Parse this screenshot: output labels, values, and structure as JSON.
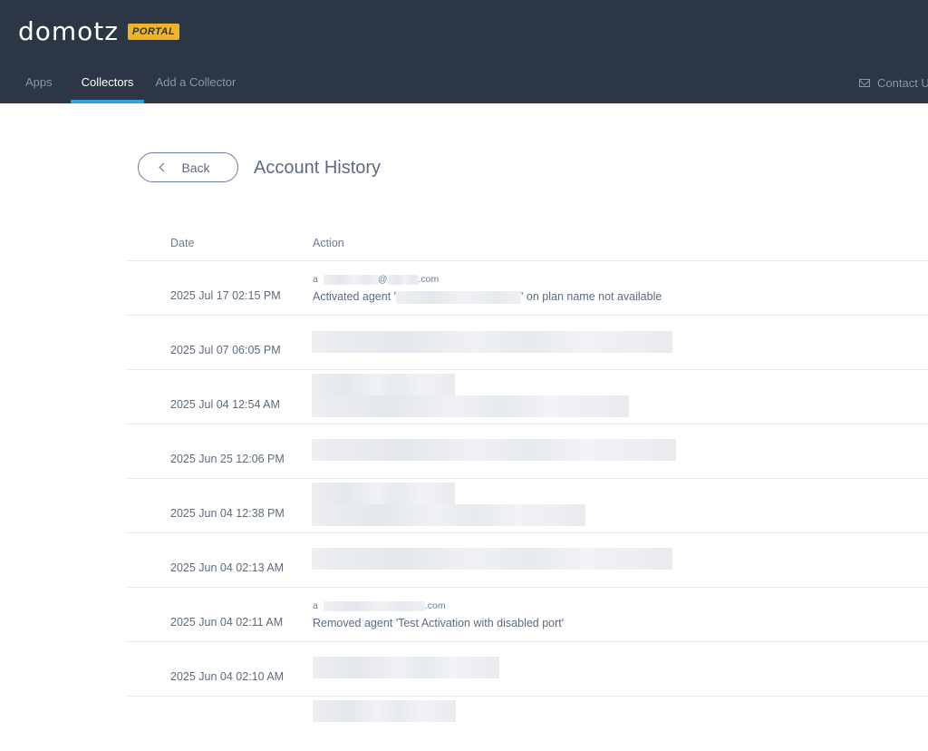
{
  "header": {
    "logo_text": "domotz",
    "badge": "PORTAL",
    "tabs": [
      {
        "label": "Apps",
        "active": false
      },
      {
        "label": "Collectors",
        "active": true
      },
      {
        "label": "Add a Collector",
        "active": false
      }
    ],
    "contact_label": "Contact U"
  },
  "page": {
    "back_label": "Back",
    "title": "Account History"
  },
  "table": {
    "columns": [
      "Date",
      "Action"
    ],
    "rows": [
      {
        "date": "2025 Jul 17 02:15 PM",
        "user_prefix": "a",
        "user_at": "@",
        "user_suffix": ".com",
        "action_prefix": "Activated agent '",
        "action_suffix": "' on plan name not available"
      },
      {
        "date": "2025 Jul 07 06:05 PM"
      },
      {
        "date": "2025 Jul 04 12:54 AM"
      },
      {
        "date": "2025 Jun 25 12:06 PM"
      },
      {
        "date": "2025 Jun 04 12:38 PM"
      },
      {
        "date": "2025 Jun 04 02:13 AM"
      },
      {
        "date": "2025 Jun 04 02:11 AM",
        "user_prefix": "a",
        "user_suffix": ".com",
        "action": "Removed agent 'Test Activation with disabled port'"
      },
      {
        "date": "2025 Jun 04 02:10 AM"
      }
    ]
  },
  "colors": {
    "topbar": "#2c3644",
    "accent": "#2f9fe6",
    "badge": "#f0b429"
  }
}
